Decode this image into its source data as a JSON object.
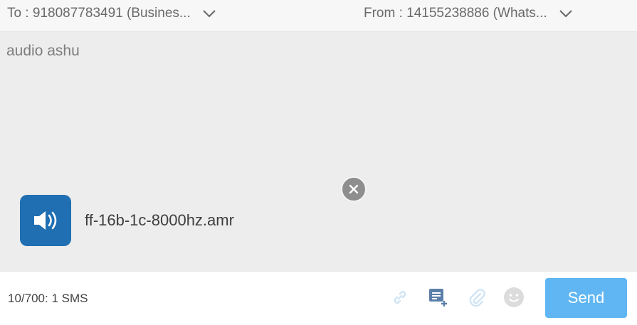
{
  "header": {
    "to_label": "To : 918087783491 (Busines...",
    "from_label": "From : 14155238886 (Whats..."
  },
  "compose": {
    "message_text": "audio ashu",
    "attachment": {
      "file_name": "ff-16b-1c-8000hz.amr",
      "icon": "audio-file-icon"
    }
  },
  "footer": {
    "counter": "10/700: 1 SMS",
    "tools": [
      "link-icon",
      "template-icon",
      "attachment-icon",
      "emoji-icon"
    ],
    "send_label": "Send"
  },
  "colors": {
    "send_button": "#60b6f2",
    "file_icon_bg": "#1f6fb2",
    "compose_bg": "#ededed"
  }
}
